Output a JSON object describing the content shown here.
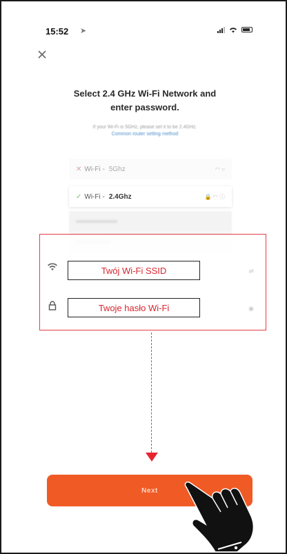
{
  "status_bar": {
    "time": "15:52"
  },
  "header": {
    "title_line1": "Select 2.4 GHz Wi-Fi Network and",
    "title_line2": "enter password.",
    "hint": "If your Wi-Fi is 5GHz, please set it to be 2.4GHz.",
    "hint_link": "Common router setting method"
  },
  "networks": [
    {
      "name": "Wi-Fi -",
      "band": "5Ghz",
      "state": "unsupported"
    },
    {
      "name": "Wi-Fi -",
      "band": "2.4Ghz",
      "state": "selected"
    },
    {
      "name": "",
      "band": "",
      "state": "other"
    },
    {
      "name": "",
      "band": "",
      "state": "other"
    }
  ],
  "form": {
    "ssid_label": "Twój Wi-Fi SSID",
    "password_label": "Twoje hasło Wi-Fi"
  },
  "actions": {
    "next_label": "Next"
  },
  "colors": {
    "accent": "#f05a25",
    "highlight": "#e53a44"
  },
  "icons": [
    "location-arrow-icon",
    "signal-icon",
    "wifi-icon",
    "battery-icon",
    "close-icon",
    "lock-icon",
    "hand-pointer-icon"
  ]
}
